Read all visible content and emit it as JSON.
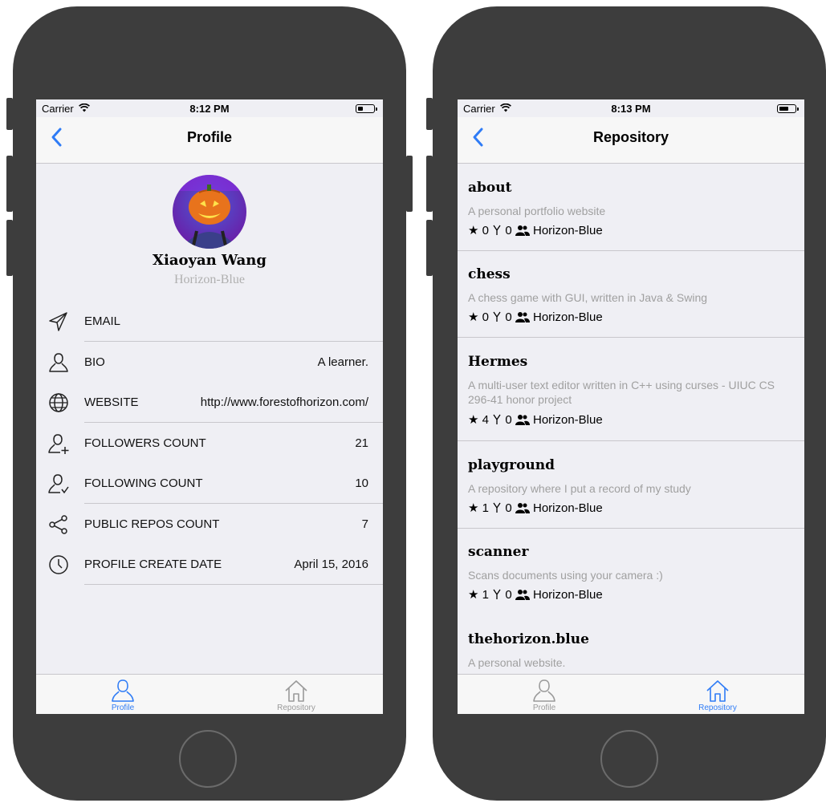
{
  "colors": {
    "accent": "#2f7cf6",
    "frame": "#3d3d3d",
    "screen_bg": "#efeff4",
    "muted": "#a0a0a0"
  },
  "left_phone": {
    "status": {
      "carrier": "Carrier",
      "time": "8:12 PM",
      "battery_level": 0.35
    },
    "nav": {
      "title": "Profile",
      "back_icon": "chevron-left-icon"
    },
    "profile": {
      "name": "Xiaoyan Wang",
      "login": "Horizon-Blue",
      "rows": [
        {
          "icon": "paper-plane-icon",
          "label": "EMAIL",
          "value": ""
        },
        {
          "icon": "person-icon",
          "label": "BIO",
          "value": "A learner."
        },
        {
          "icon": "globe-icon",
          "label": "WEBSITE",
          "value": "http://www.forestofhorizon.com/"
        },
        {
          "icon": "person-plus-icon",
          "label": "FOLLOWERS COUNT",
          "value": "21"
        },
        {
          "icon": "person-check-icon",
          "label": "FOLLOWING COUNT",
          "value": "10"
        },
        {
          "icon": "share-icon",
          "label": "PUBLIC REPOS COUNT",
          "value": "7"
        },
        {
          "icon": "clock-icon",
          "label": "PROFILE CREATE DATE",
          "value": "April 15, 2016"
        }
      ]
    },
    "tabs": [
      {
        "label": "Profile",
        "icon": "person-icon",
        "active": true
      },
      {
        "label": "Repository",
        "icon": "home-icon",
        "active": false
      }
    ]
  },
  "right_phone": {
    "status": {
      "carrier": "Carrier",
      "time": "8:13 PM",
      "battery_level": 0.6
    },
    "nav": {
      "title": "Repository",
      "back_icon": "chevron-left-icon"
    },
    "repos": [
      {
        "name": "about",
        "description": "A personal portfolio website",
        "stars": "0",
        "forks": "0",
        "owner": "Horizon-Blue"
      },
      {
        "name": "chess",
        "description": "A chess game with GUI, written in Java & Swing",
        "stars": "0",
        "forks": "0",
        "owner": "Horizon-Blue"
      },
      {
        "name": "Hermes",
        "description": "A multi-user text editor written in C++ using curses - UIUC CS 296-41 honor project",
        "stars": "4",
        "forks": "0",
        "owner": "Horizon-Blue"
      },
      {
        "name": "playground",
        "description": "A repository where I put a record of my study",
        "stars": "1",
        "forks": "0",
        "owner": "Horizon-Blue"
      },
      {
        "name": "scanner",
        "description": "Scans documents using your camera :)",
        "stars": "1",
        "forks": "0",
        "owner": "Horizon-Blue"
      },
      {
        "name": "thehorizon.blue",
        "description": "A personal website.",
        "stars": "",
        "forks": "",
        "owner": ""
      }
    ],
    "tabs": [
      {
        "label": "Profile",
        "icon": "person-icon",
        "active": false
      },
      {
        "label": "Repository",
        "icon": "home-icon",
        "active": true
      }
    ]
  }
}
